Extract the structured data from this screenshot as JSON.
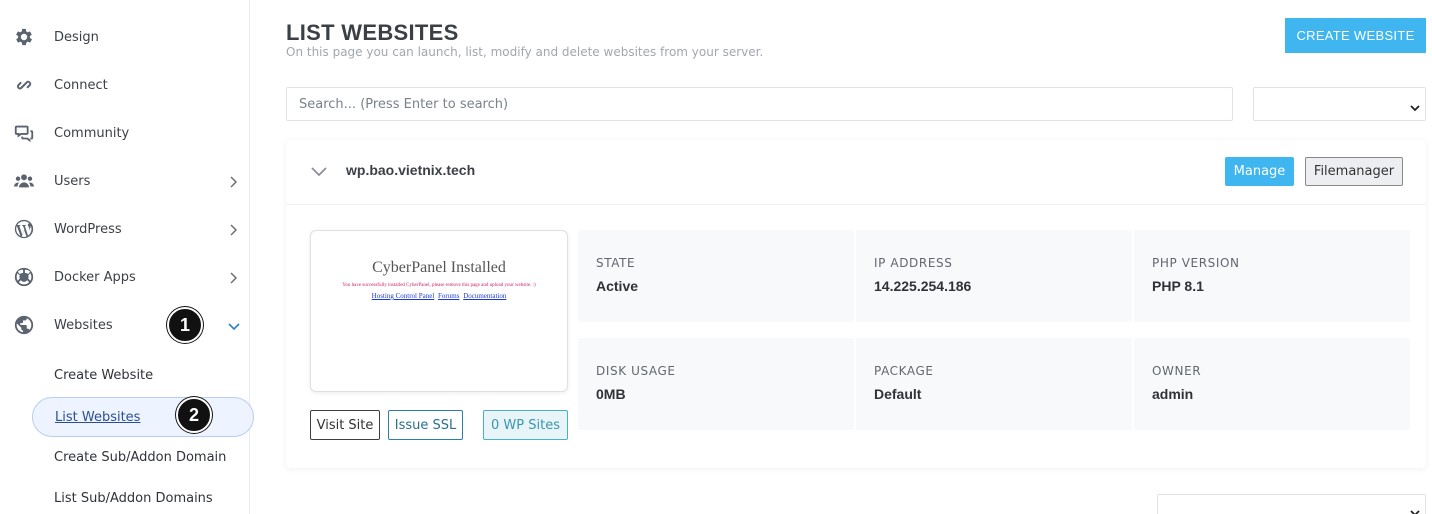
{
  "sidebar": {
    "items": [
      {
        "label": "Design",
        "icon": "gear-icon",
        "has_chevron": false
      },
      {
        "label": "Connect",
        "icon": "link-icon",
        "has_chevron": false
      },
      {
        "label": "Community",
        "icon": "chat-icon",
        "has_chevron": false
      },
      {
        "label": "Users",
        "icon": "users-icon",
        "has_chevron": true
      },
      {
        "label": "WordPress",
        "icon": "wordpress-icon",
        "has_chevron": true
      },
      {
        "label": "Docker Apps",
        "icon": "docker-icon",
        "has_chevron": true
      },
      {
        "label": "Websites",
        "icon": "globe-icon",
        "has_chevron": true,
        "expanded": true
      }
    ],
    "submenu": [
      {
        "label": "Create Website"
      },
      {
        "label": "List Websites",
        "active": true
      },
      {
        "label": "Create Sub/Addon Domain"
      },
      {
        "label": "List Sub/Addon Domains"
      }
    ],
    "badges": [
      "1",
      "2"
    ]
  },
  "header": {
    "title": "LIST WEBSITES",
    "subtitle": "On this page you can launch, list, modify and delete websites from your server.",
    "create_button": "CREATE WEBSITE"
  },
  "search": {
    "placeholder": "Search... (Press Enter to search)"
  },
  "website": {
    "domain": "wp.bao.vietnix.tech",
    "manage_label": "Manage",
    "filemanager_label": "Filemanager",
    "preview": {
      "title": "CyberPanel Installed",
      "text": "You have successfully installed CyberPanel, please remove this page and upload your website. :)",
      "links": [
        "Hosting Control Panel",
        "Forums",
        "Documentation"
      ]
    },
    "visit_label": "Visit Site",
    "ssl_label": "Issue SSL",
    "wp_sites_label": "0 WP Sites",
    "info": [
      {
        "label": "STATE",
        "value": "Active"
      },
      {
        "label": "IP ADDRESS",
        "value": "14.225.254.186"
      },
      {
        "label": "PHP VERSION",
        "value": "PHP 8.1"
      },
      {
        "label": "DISK USAGE",
        "value": "0MB"
      },
      {
        "label": "PACKAGE",
        "value": "Default"
      },
      {
        "label": "OWNER",
        "value": "admin"
      }
    ]
  },
  "colors": {
    "accent": "#3fb6ef",
    "sidebar_active_bg": "#eef4ff",
    "text": "#3b3f46"
  }
}
